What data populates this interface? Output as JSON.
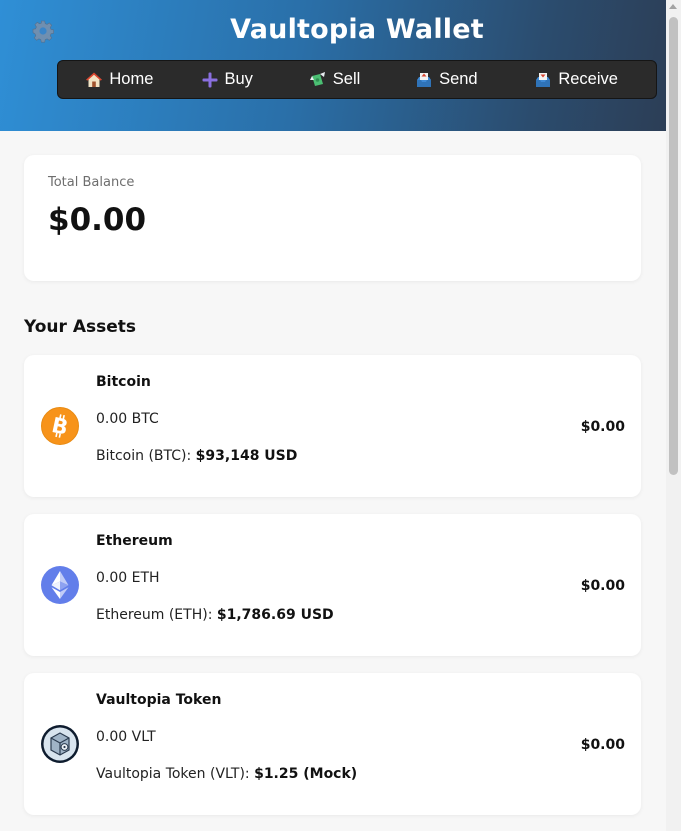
{
  "app": {
    "title": "Vaultopia Wallet",
    "settings_icon": "gear-icon",
    "accent_gradient": [
      "#2f8fd6",
      "#2c3e56"
    ]
  },
  "nav": {
    "items": [
      {
        "label": "Home",
        "icon": "house-icon"
      },
      {
        "label": "Buy",
        "icon": "plus-icon"
      },
      {
        "label": "Sell",
        "icon": "money-wings-icon"
      },
      {
        "label": "Send",
        "icon": "outbox-icon"
      },
      {
        "label": "Receive",
        "icon": "inbox-icon"
      }
    ]
  },
  "balance": {
    "label": "Total Balance",
    "value": "$0.00"
  },
  "assets": {
    "heading": "Your Assets",
    "items": [
      {
        "name": "Bitcoin",
        "amount": "0.00 BTC",
        "price_label": "Bitcoin (BTC):",
        "price_value": "$93,148 USD",
        "value": "$0.00",
        "icon": "bitcoin-icon",
        "color": "#f7931a"
      },
      {
        "name": "Ethereum",
        "amount": "0.00 ETH",
        "price_label": "Ethereum (ETH):",
        "price_value": "$1,786.69 USD",
        "value": "$0.00",
        "icon": "ethereum-icon",
        "color": "#627eea"
      },
      {
        "name": "Vaultopia Token",
        "amount": "0.00 VLT",
        "price_label": "Vaultopia Token (VLT):",
        "price_value": "$1.25 (Mock)",
        "value": "$0.00",
        "icon": "vault-token-icon",
        "color": "#1e2f4a"
      }
    ]
  }
}
